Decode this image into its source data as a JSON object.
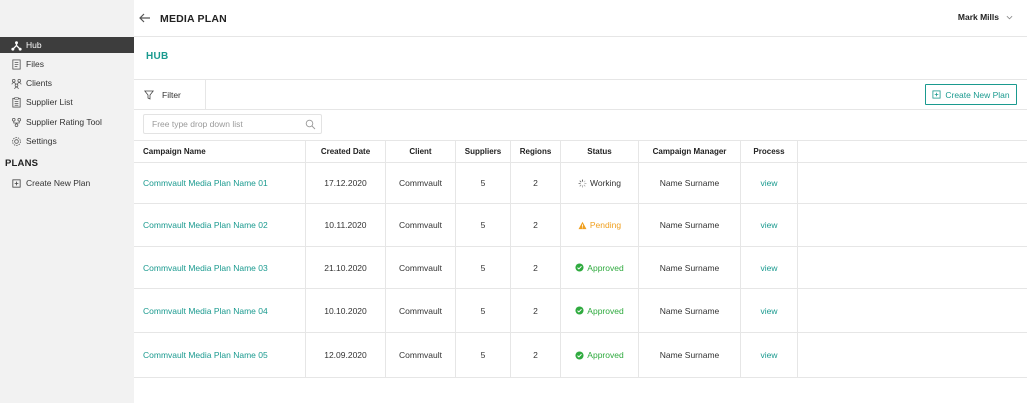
{
  "colors": {
    "accent": "#1a9a8f",
    "pending": "#f0a020",
    "approved": "#2eaa3e",
    "sidebar_bg": "#f2f2f2",
    "active_bg": "#3d3d3d"
  },
  "header": {
    "title": "MEDIA PLAN",
    "user": "Mark Mills"
  },
  "sidebar": {
    "items": [
      {
        "label": "Hub",
        "icon": "hub-icon"
      },
      {
        "label": "Files",
        "icon": "file-icon"
      },
      {
        "label": "Clients",
        "icon": "clients-icon"
      },
      {
        "label": "Supplier List",
        "icon": "list-icon"
      },
      {
        "label": "Supplier Rating Tool",
        "icon": "rating-icon"
      },
      {
        "label": "Settings",
        "icon": "gear-icon"
      }
    ],
    "plans_heading": "PLANS",
    "plans_items": [
      {
        "label": "Create New Plan",
        "icon": "plus-square-icon"
      }
    ]
  },
  "hub": {
    "title": "HUB"
  },
  "toolbar": {
    "filter_label": "Filter",
    "create_label": "Create New Plan"
  },
  "search": {
    "placeholder": "Free type drop down list"
  },
  "table": {
    "headers": {
      "name": "Campaign Name",
      "date": "Created Date",
      "client": "Client",
      "suppliers": "Suppliers",
      "regions": "Regions",
      "status": "Status",
      "manager": "Campaign Manager",
      "process": "Process"
    },
    "rows": [
      {
        "name": "Commvault Media Plan Name 01",
        "date": "17.12.2020",
        "client": "Commvault",
        "suppliers": "5",
        "regions": "2",
        "status": "Working",
        "manager": "Name Surname",
        "process": "view"
      },
      {
        "name": "Commvault Media Plan Name 02",
        "date": "10.11.2020",
        "client": "Commvault",
        "suppliers": "5",
        "regions": "2",
        "status": "Pending",
        "manager": "Name Surname",
        "process": "view"
      },
      {
        "name": "Commvault Media Plan Name 03",
        "date": "21.10.2020",
        "client": "Commvault",
        "suppliers": "5",
        "regions": "2",
        "status": "Approved",
        "manager": "Name Surname",
        "process": "view"
      },
      {
        "name": "Commvault Media Plan Name 04",
        "date": "10.10.2020",
        "client": "Commvault",
        "suppliers": "5",
        "regions": "2",
        "status": "Approved",
        "manager": "Name Surname",
        "process": "view"
      },
      {
        "name": "Commvault Media Plan Name 05",
        "date": "12.09.2020",
        "client": "Commvault",
        "suppliers": "5",
        "regions": "2",
        "status": "Approved",
        "manager": "Name Surname",
        "process": "view"
      }
    ]
  }
}
